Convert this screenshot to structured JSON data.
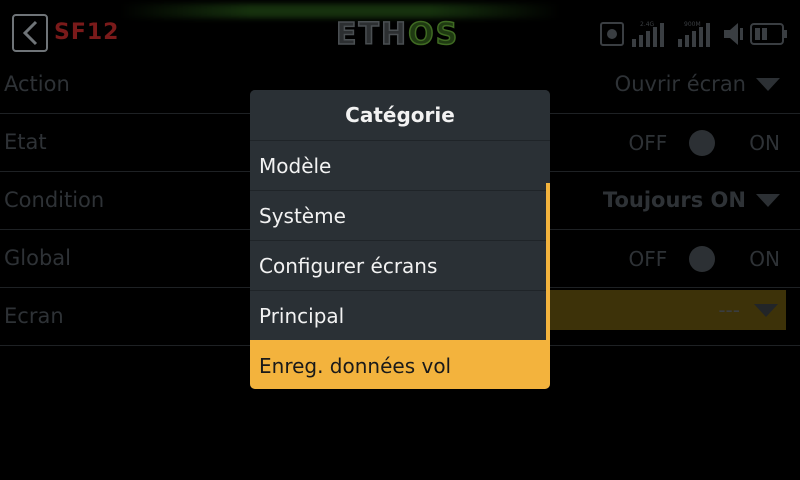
{
  "topbar": {
    "back_icon": "chevron-left-icon",
    "title": "SF12",
    "brand_part1": "ETH",
    "brand_part2": "OS",
    "status_icons": [
      "sd-card-icon",
      "rf-signal-2g4-icon",
      "rf-signal-900m-icon",
      "volume-icon",
      "battery-icon"
    ],
    "signal_label_1": "2.4G",
    "signal_label_2": "900M"
  },
  "rows": [
    {
      "label": "Action",
      "value": "Ouvrir écran",
      "kind": "dropdown"
    },
    {
      "label": "Etat",
      "off": "OFF",
      "on": "ON",
      "kind": "toggle"
    },
    {
      "label": "Condition",
      "value": "Toujours ON",
      "kind": "dropdown"
    },
    {
      "label": "Global",
      "off": "OFF",
      "on": "ON",
      "kind": "toggle"
    },
    {
      "label": "Ecran",
      "value": "---",
      "kind": "dropdown"
    }
  ],
  "modal": {
    "title": "Catégorie",
    "options": [
      "Modèle",
      "Système",
      "Configurer écrans",
      "Principal",
      "Enreg. données vol"
    ],
    "selected_index": 4
  },
  "colors": {
    "accent": "#f3b33d",
    "modal_bg": "#2a3035",
    "title_red": "#7a1a1a",
    "brand_green": "#3f6a22"
  }
}
